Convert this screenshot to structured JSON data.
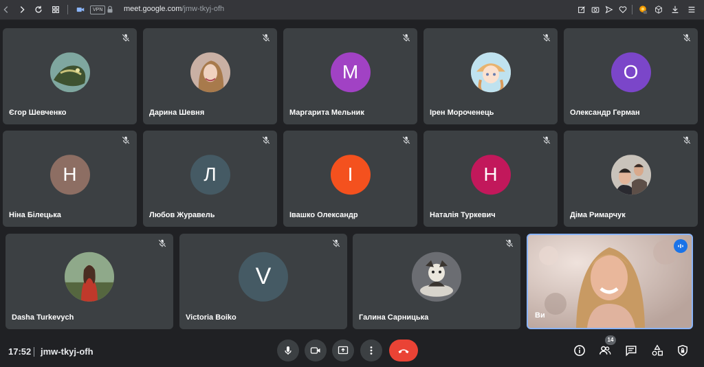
{
  "browser": {
    "url_domain": "meet.google.com",
    "url_path": "/jmw-tkyj-ofh",
    "vpn_label": "VPN"
  },
  "participants": [
    {
      "name": "Єгор Шевченко",
      "initial": "",
      "color": "#3b4a2e",
      "muted": true
    },
    {
      "name": "Дарина Шевня",
      "initial": "",
      "color": "#8a6d5c",
      "muted": true
    },
    {
      "name": "Маргарита Мельник",
      "initial": "M",
      "color": "#a142c4",
      "muted": true
    },
    {
      "name": "Ірен Мороченець",
      "initial": "",
      "color": "#f2d2b8",
      "muted": true
    },
    {
      "name": "Олександр Герман",
      "initial": "O",
      "color": "#7b46c9",
      "muted": true
    },
    {
      "name": "Ніна Білецька",
      "initial": "Н",
      "color": "#8d6e63",
      "muted": true
    },
    {
      "name": "Любов Журавель",
      "initial": "Л",
      "color": "#455a64",
      "muted": true
    },
    {
      "name": "Івашко Олександр",
      "initial": "І",
      "color": "#f4511e",
      "muted": true
    },
    {
      "name": "Наталія Туркевич",
      "initial": "Н",
      "color": "#c2185b",
      "muted": true
    },
    {
      "name": "Діма Римарчук",
      "initial": "",
      "color": "#7a7470",
      "muted": true
    },
    {
      "name": "Dasha Turkevych",
      "initial": "",
      "color": "#6e7d5a",
      "muted": true
    },
    {
      "name": "Victoria Boiko",
      "initial": "V",
      "color": "#455a64",
      "muted": true
    },
    {
      "name": "Галина Сарницька",
      "initial": "",
      "color": "#6b6d72",
      "muted": true
    }
  ],
  "self": {
    "name": "Ви",
    "speaking": true
  },
  "bottom": {
    "time": "17:52",
    "meeting_code": "jmw-tkyj-ofh",
    "participant_count": "14"
  },
  "colors": {
    "background": "#202124",
    "tile": "#3c4043",
    "hangup": "#ea4335",
    "accent": "#8ab4f8"
  },
  "icons": {
    "tile_muted": "mic-off-icon",
    "controls": [
      "mic-icon",
      "camera-icon",
      "present-icon",
      "more-vert-icon",
      "hangup-icon"
    ],
    "right": [
      "info-icon",
      "people-icon",
      "chat-icon",
      "activities-icon",
      "host-controls-icon"
    ]
  }
}
